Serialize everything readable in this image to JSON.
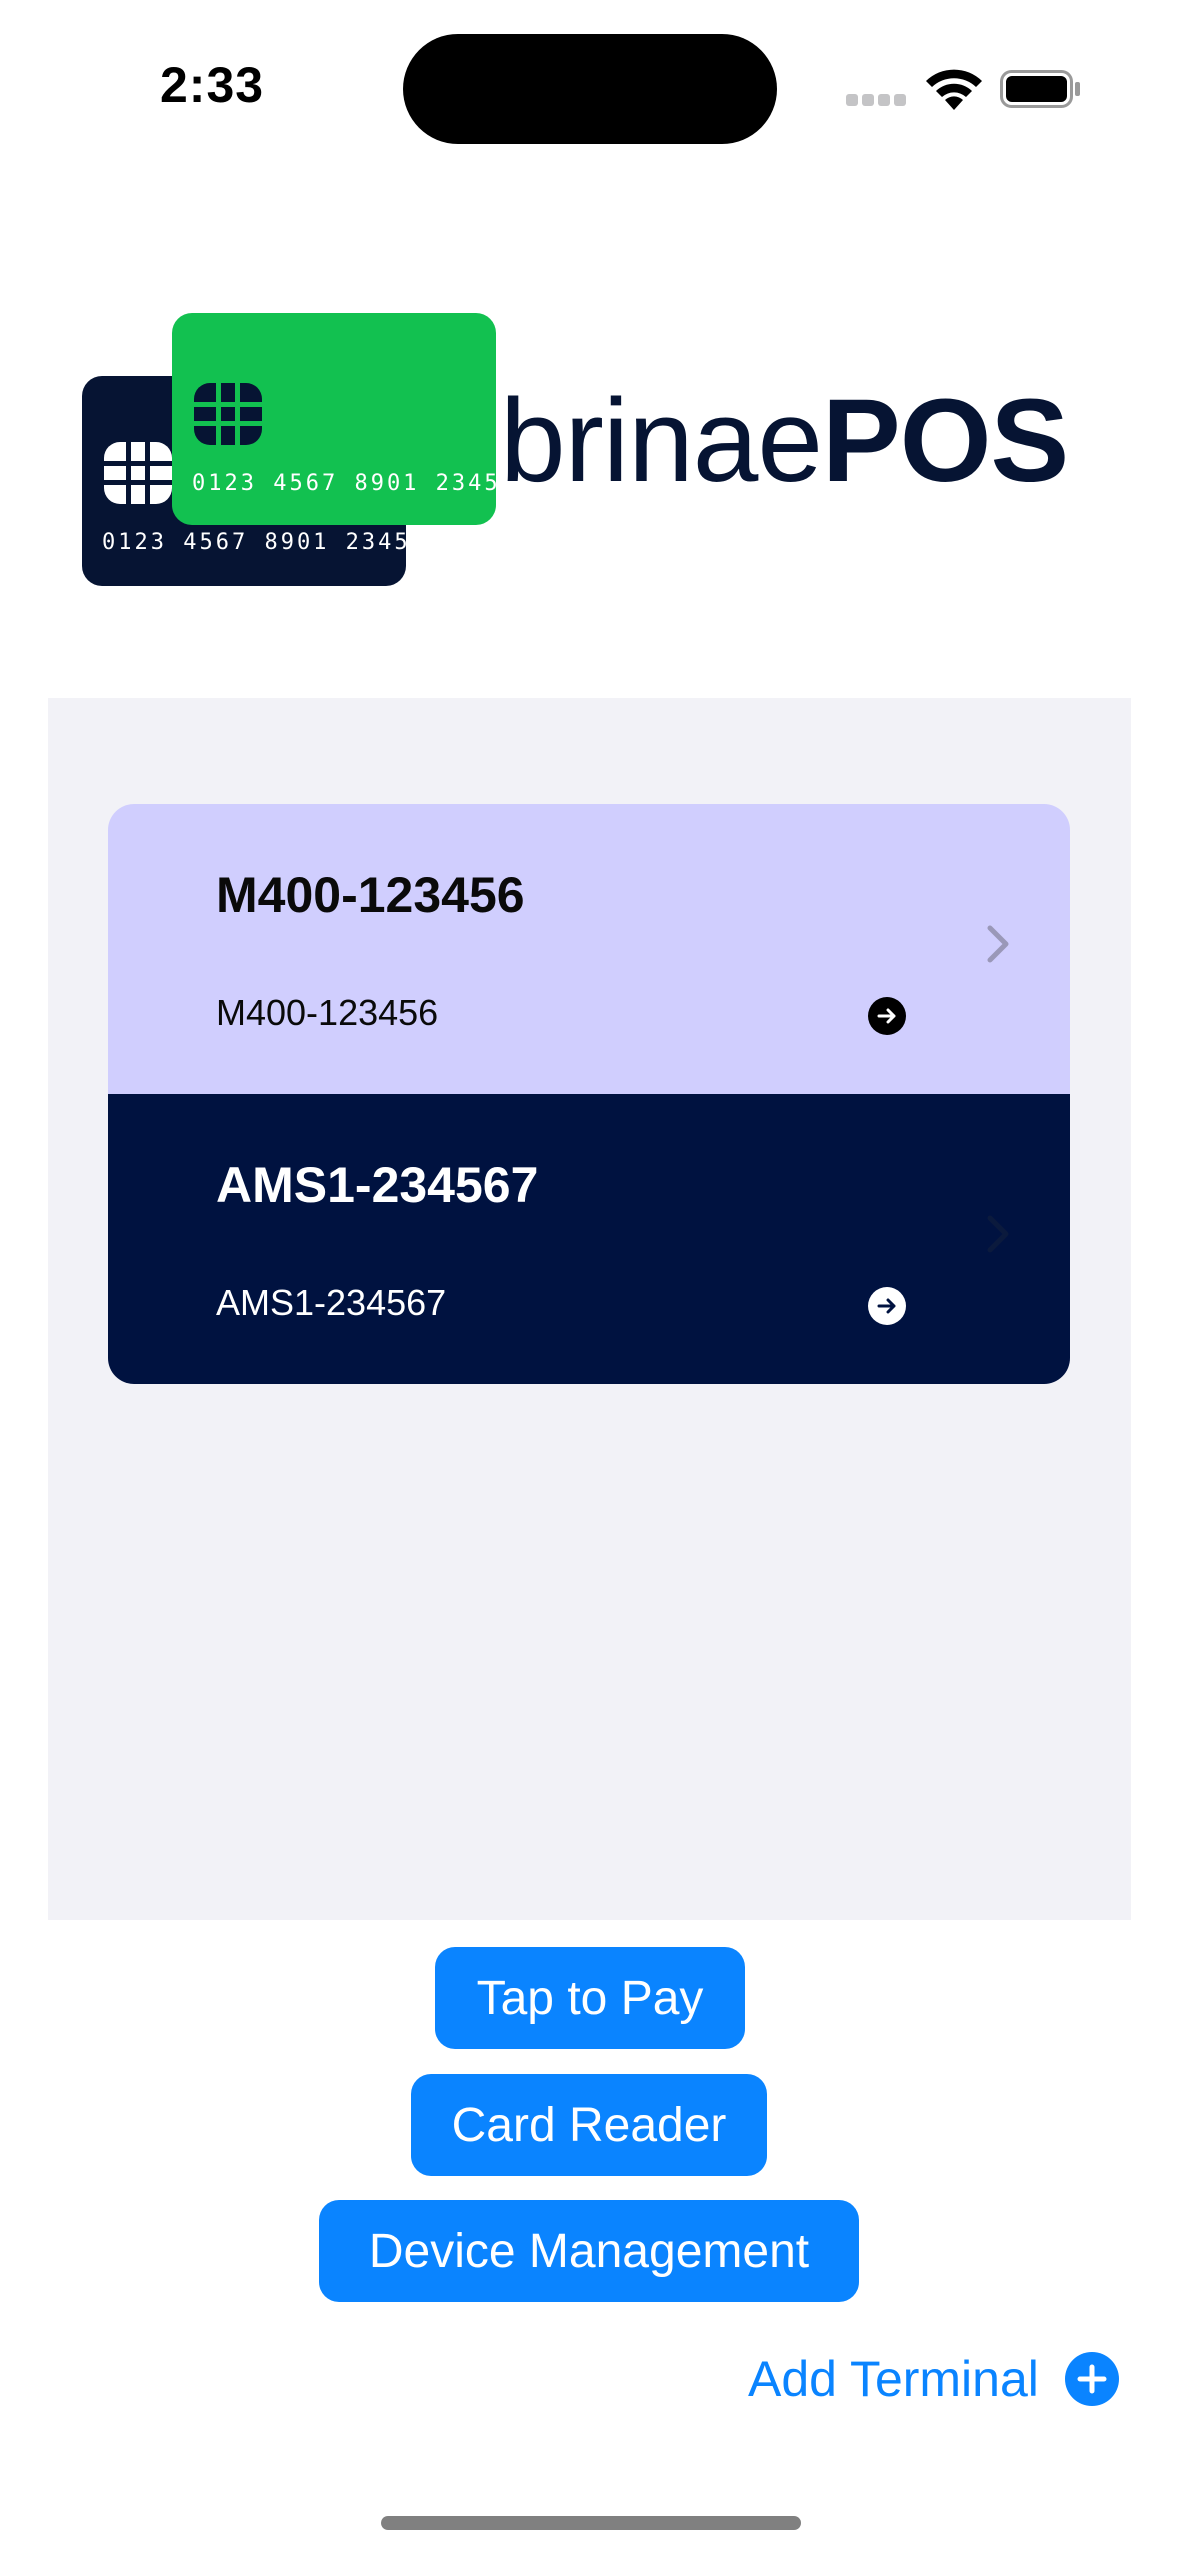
{
  "status_bar": {
    "time": "2:33"
  },
  "logo": {
    "brand_light": "brinae",
    "brand_bold": "POS",
    "card_front_number": "0123 4567 8901 2345",
    "card_back_number": "0123 4567 8901 2345",
    "colors": {
      "navy": "#061433",
      "green": "#12c150"
    }
  },
  "terminals": [
    {
      "title": "M400-123456",
      "subtitle": "M400-123456",
      "background": "#d0cefe"
    },
    {
      "title": "AMS1-234567",
      "subtitle": "AMS1-234567",
      "background": "#001240"
    }
  ],
  "actions": {
    "tap_to_pay": "Tap to Pay",
    "card_reader": "Card Reader",
    "device_management": "Device Management",
    "add_terminal": "Add Terminal"
  },
  "colors": {
    "accent": "#0a84ff",
    "panel": "#f2f2f7"
  },
  "icons": [
    "wifi-icon",
    "battery-icon",
    "signal-icon",
    "arrow-right-circle-icon",
    "chevron-right-icon",
    "plus-circle-icon",
    "card-chip-icon"
  ]
}
